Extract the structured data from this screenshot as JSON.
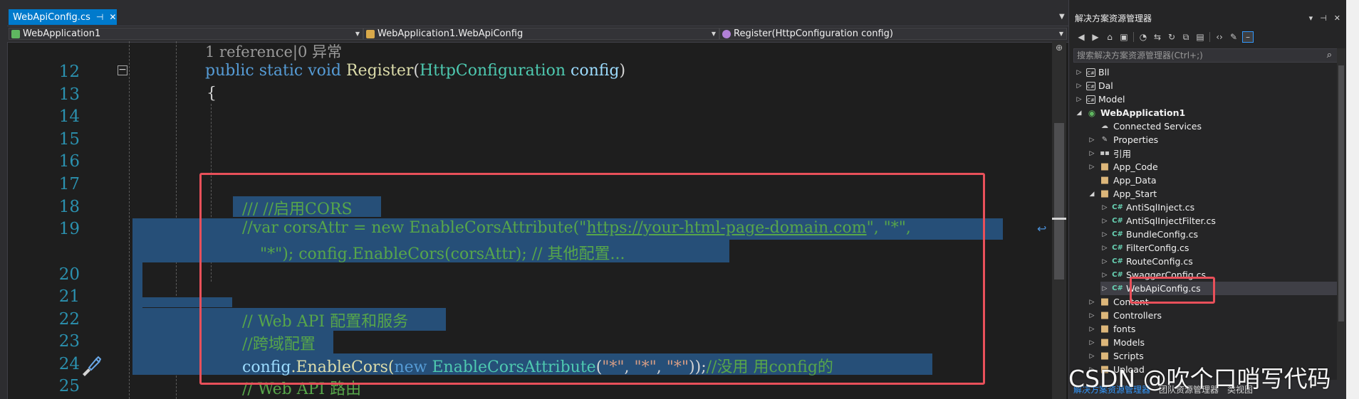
{
  "tab": {
    "label": "WebApiConfig.cs",
    "pin": "⊣",
    "close": "✕"
  },
  "navbar": {
    "project": "WebApplication1",
    "class": "WebApplication1.WebApiConfig",
    "member": "Register(HttpConfiguration config)"
  },
  "code": {
    "codelens": "1 reference|0 异常",
    "line_numbers": [
      "12",
      "13",
      "14",
      "15",
      "16",
      "17",
      "18",
      "19",
      "20",
      "21",
      "22",
      "23",
      "24",
      "25"
    ],
    "line12": {
      "public": "public",
      "static": "static",
      "void": "void",
      "method": "Register",
      "paren_open": "(",
      "type": "HttpConfiguration",
      "param": "config",
      "paren_close": ")"
    },
    "line13": "{",
    "line18": "/// //启用CORS",
    "line19a_pre": "//var corsAttr = new EnableCorsAttribute(\"",
    "line19a_url": "https://your-html-page-domain.com",
    "line19a_post": "\", \"*\",",
    "line19b": "\"*\"); config.EnableCors(corsAttr); // 其他配置...",
    "line22": "// Web API 配置和服务",
    "line23": "//跨域配置",
    "line24": {
      "obj": "config",
      "dot_method": ".EnableCors(",
      "new": "new",
      "attr_type": "EnableCorsAttribute",
      "paren": "(",
      "s1": "\"*\"",
      "comma1": ", ",
      "s2": "\"*\"",
      "comma2": ", ",
      "s3": "\"*\"",
      "tail": "));",
      "comment": "//没用 用config的"
    },
    "line25": "// Web API 路由"
  },
  "solution_explorer": {
    "title": "解决方案资源管理器",
    "title_buttons": [
      "▾",
      "⊣",
      "✕"
    ],
    "search_placeholder": "搜索解决方案资源管理器(Ctrl+;)",
    "tree": [
      {
        "label": "Bll",
        "icon": "project",
        "expander": "▷"
      },
      {
        "label": "Dal",
        "icon": "project",
        "expander": "▷"
      },
      {
        "label": "Model",
        "icon": "project",
        "expander": "▷"
      },
      {
        "label": "WebApplication1",
        "icon": "web-project",
        "expander": "◢",
        "bold": true
      },
      {
        "label": "Connected Services",
        "icon": "cloud",
        "expander": ""
      },
      {
        "label": "Properties",
        "icon": "wrench",
        "expander": "▷"
      },
      {
        "label": "引用",
        "icon": "refs",
        "expander": "▷"
      },
      {
        "label": "App_Code",
        "icon": "folder",
        "expander": "▷"
      },
      {
        "label": "App_Data",
        "icon": "folder",
        "expander": ""
      },
      {
        "label": "App_Start",
        "icon": "folder",
        "expander": "◢"
      },
      {
        "label": "AntiSqlInject.cs",
        "icon": "cs",
        "expander": "▷"
      },
      {
        "label": "AntiSqlInjectFilter.cs",
        "icon": "cs",
        "expander": "▷"
      },
      {
        "label": "BundleConfig.cs",
        "icon": "cs",
        "expander": "▷"
      },
      {
        "label": "FilterConfig.cs",
        "icon": "cs",
        "expander": "▷"
      },
      {
        "label": "RouteConfig.cs",
        "icon": "cs",
        "expander": "▷"
      },
      {
        "label": "SwaggerConfig.cs",
        "icon": "cs",
        "expander": "▷"
      },
      {
        "label": "WebApiConfig.cs",
        "icon": "cs",
        "expander": "▷",
        "selected": true
      },
      {
        "label": "Content",
        "icon": "folder",
        "expander": "▷"
      },
      {
        "label": "Controllers",
        "icon": "folder",
        "expander": "▷"
      },
      {
        "label": "fonts",
        "icon": "folder",
        "expander": "▷"
      },
      {
        "label": "Models",
        "icon": "folder",
        "expander": "▷"
      },
      {
        "label": "Scripts",
        "icon": "folder",
        "expander": "▷"
      },
      {
        "label": "Upload",
        "icon": "folder",
        "expander": "▷"
      }
    ],
    "bottom_tabs": [
      "解决方案资源管理器",
      "团队资源管理器",
      "类视图"
    ]
  },
  "watermark": "CSDN @吹个口哨写代码",
  "colors": {
    "accent": "#007acc",
    "highlight": "#e8505a",
    "selection": "#264f78"
  }
}
